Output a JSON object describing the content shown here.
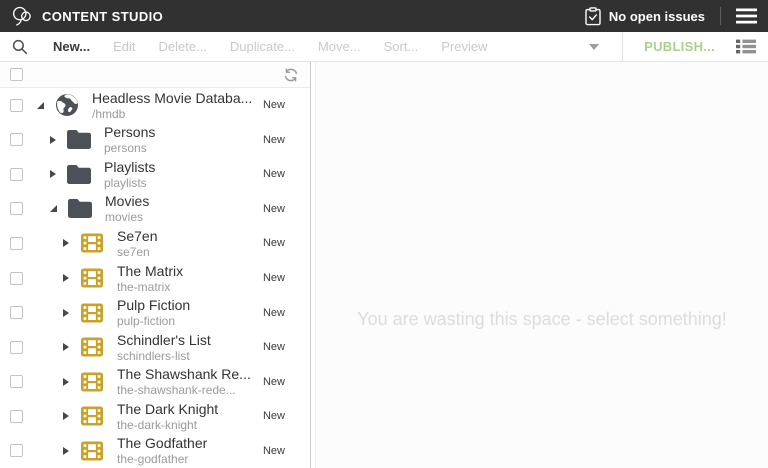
{
  "topbar": {
    "app_name": "CONTENT STUDIO",
    "issues_label": "No open issues"
  },
  "toolbar": {
    "buttons": [
      {
        "label": "New...",
        "enabled": true
      },
      {
        "label": "Edit",
        "enabled": false
      },
      {
        "label": "Delete...",
        "enabled": false
      },
      {
        "label": "Duplicate...",
        "enabled": false
      },
      {
        "label": "Move...",
        "enabled": false
      },
      {
        "label": "Sort...",
        "enabled": false
      },
      {
        "label": "Preview",
        "enabled": false
      }
    ],
    "publish_label": "PUBLISH..."
  },
  "tree": {
    "rows": [
      {
        "level": 0,
        "state": "expanded",
        "icon": "globe-icon",
        "title": "Headless Movie Databa...",
        "path": "/hmdb",
        "status": "New"
      },
      {
        "level": 1,
        "state": "collapsed",
        "icon": "folder-icon",
        "title": "Persons",
        "path": "persons",
        "status": "New"
      },
      {
        "level": 1,
        "state": "collapsed",
        "icon": "folder-icon",
        "title": "Playlists",
        "path": "playlists",
        "status": "New"
      },
      {
        "level": 1,
        "state": "expanded",
        "icon": "folder-icon",
        "title": "Movies",
        "path": "movies",
        "status": "New"
      },
      {
        "level": 2,
        "state": "collapsed",
        "icon": "film-icon",
        "title": "Se7en",
        "path": "se7en",
        "status": "New"
      },
      {
        "level": 2,
        "state": "collapsed",
        "icon": "film-icon",
        "title": "The Matrix",
        "path": "the-matrix",
        "status": "New"
      },
      {
        "level": 2,
        "state": "collapsed",
        "icon": "film-icon",
        "title": "Pulp Fiction",
        "path": "pulp-fiction",
        "status": "New"
      },
      {
        "level": 2,
        "state": "collapsed",
        "icon": "film-icon",
        "title": "Schindler's List",
        "path": "schindlers-list",
        "status": "New"
      },
      {
        "level": 2,
        "state": "collapsed",
        "icon": "film-icon",
        "title": "The Shawshank Re...",
        "path": "the-shawshank-rede...",
        "status": "New"
      },
      {
        "level": 2,
        "state": "collapsed",
        "icon": "film-icon",
        "title": "The Dark Knight",
        "path": "the-dark-knight",
        "status": "New"
      },
      {
        "level": 2,
        "state": "collapsed",
        "icon": "film-icon",
        "title": "The Godfather",
        "path": "the-godfather",
        "status": "New"
      }
    ]
  },
  "preview": {
    "placeholder": "You are wasting this space - select something!"
  },
  "colors": {
    "topbar_bg": "#313131",
    "publish_green": "#a9d18c",
    "icon_slate": "#4b5157",
    "icon_gold": "#c9a227"
  }
}
